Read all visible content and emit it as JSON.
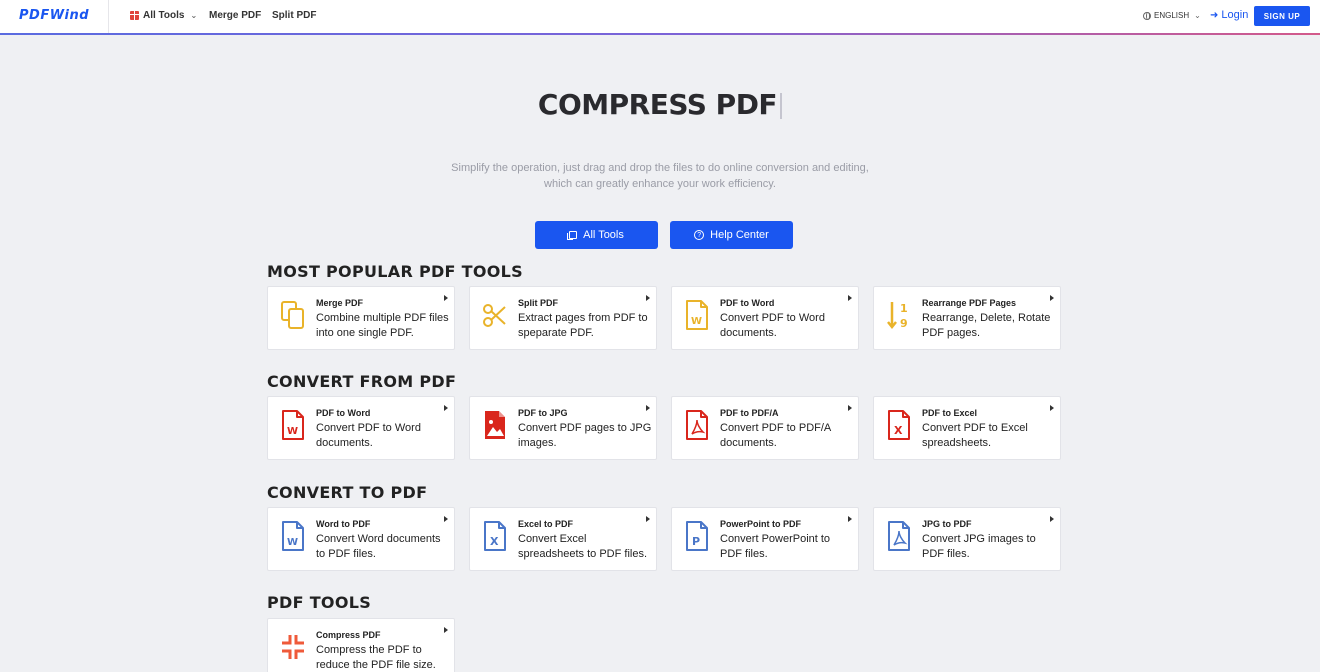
{
  "header": {
    "logo": "PDFWind",
    "nav": {
      "all_tools": "All Tools",
      "merge": "Merge PDF",
      "split": "Split PDF"
    },
    "language": "ENGLISH",
    "login": "Login",
    "signup": "SIGN UP"
  },
  "hero": {
    "title": "COMPRESS PDF",
    "subtitle": "Simplify the operation, just drag and drop the files to do online conversion and editing, which can greatly enhance your work efficiency.",
    "buttons": {
      "all_tools": "All Tools",
      "help_center": "Help Center"
    }
  },
  "sections": {
    "popular": {
      "title": "MOST POPULAR PDF TOOLS",
      "cards": [
        {
          "name": "Merge PDF",
          "desc": "Combine multiple PDF files into one single PDF.",
          "icon": "merge-icon",
          "color": "#e9b32a"
        },
        {
          "name": "Split PDF",
          "desc": "Extract pages from PDF to speparate PDF.",
          "icon": "scissors-icon",
          "color": "#e9b32a"
        },
        {
          "name": "PDF to Word",
          "desc": "Convert PDF to Word documents.",
          "icon": "word-doc-icon",
          "color": "#e9b32a"
        },
        {
          "name": "Rearrange PDF Pages",
          "desc": "Rearrange, Delete, Rotate PDF pages.",
          "icon": "sort-icon",
          "color": "#e9b32a"
        }
      ]
    },
    "from_pdf": {
      "title": "CONVERT FROM PDF",
      "cards": [
        {
          "name": "PDF to Word",
          "desc": "Convert PDF to Word documents.",
          "icon": "word-doc-icon",
          "color": "#d9261c"
        },
        {
          "name": "PDF to JPG",
          "desc": "Convert PDF pages to JPG images.",
          "icon": "image-doc-icon",
          "color": "#d9261c"
        },
        {
          "name": "PDF to PDF/A",
          "desc": "Convert PDF to PDF/A documents.",
          "icon": "pdf-doc-icon",
          "color": "#d9261c"
        },
        {
          "name": "PDF to Excel",
          "desc": "Convert PDF to Excel spreadsheets.",
          "icon": "excel-doc-icon",
          "color": "#d9261c"
        }
      ]
    },
    "to_pdf": {
      "title": "CONVERT TO PDF",
      "cards": [
        {
          "name": "Word to PDF",
          "desc": "Convert Word documents to PDF files.",
          "icon": "word-doc-icon",
          "color": "#4a76c8"
        },
        {
          "name": "Excel to PDF",
          "desc": "Convert Excel spreadsheets to PDF files.",
          "icon": "excel-doc-icon",
          "color": "#4a76c8"
        },
        {
          "name": "PowerPoint to PDF",
          "desc": "Convert PowerPoint to PDF files.",
          "icon": "powerpoint-doc-icon",
          "color": "#4a76c8"
        },
        {
          "name": "JPG to PDF",
          "desc": "Convert JPG images to PDF files.",
          "icon": "pdf-doc-icon",
          "color": "#4a76c8"
        }
      ]
    },
    "tools": {
      "title": "PDF TOOLS",
      "cards": [
        {
          "name": "Compress PDF",
          "desc": "Compress the PDF to reduce the PDF file size.",
          "icon": "compress-icon",
          "color": "#ef5a3a"
        }
      ]
    }
  },
  "colors": {
    "accent": "#1a56f0",
    "background": "#eff0f3"
  }
}
